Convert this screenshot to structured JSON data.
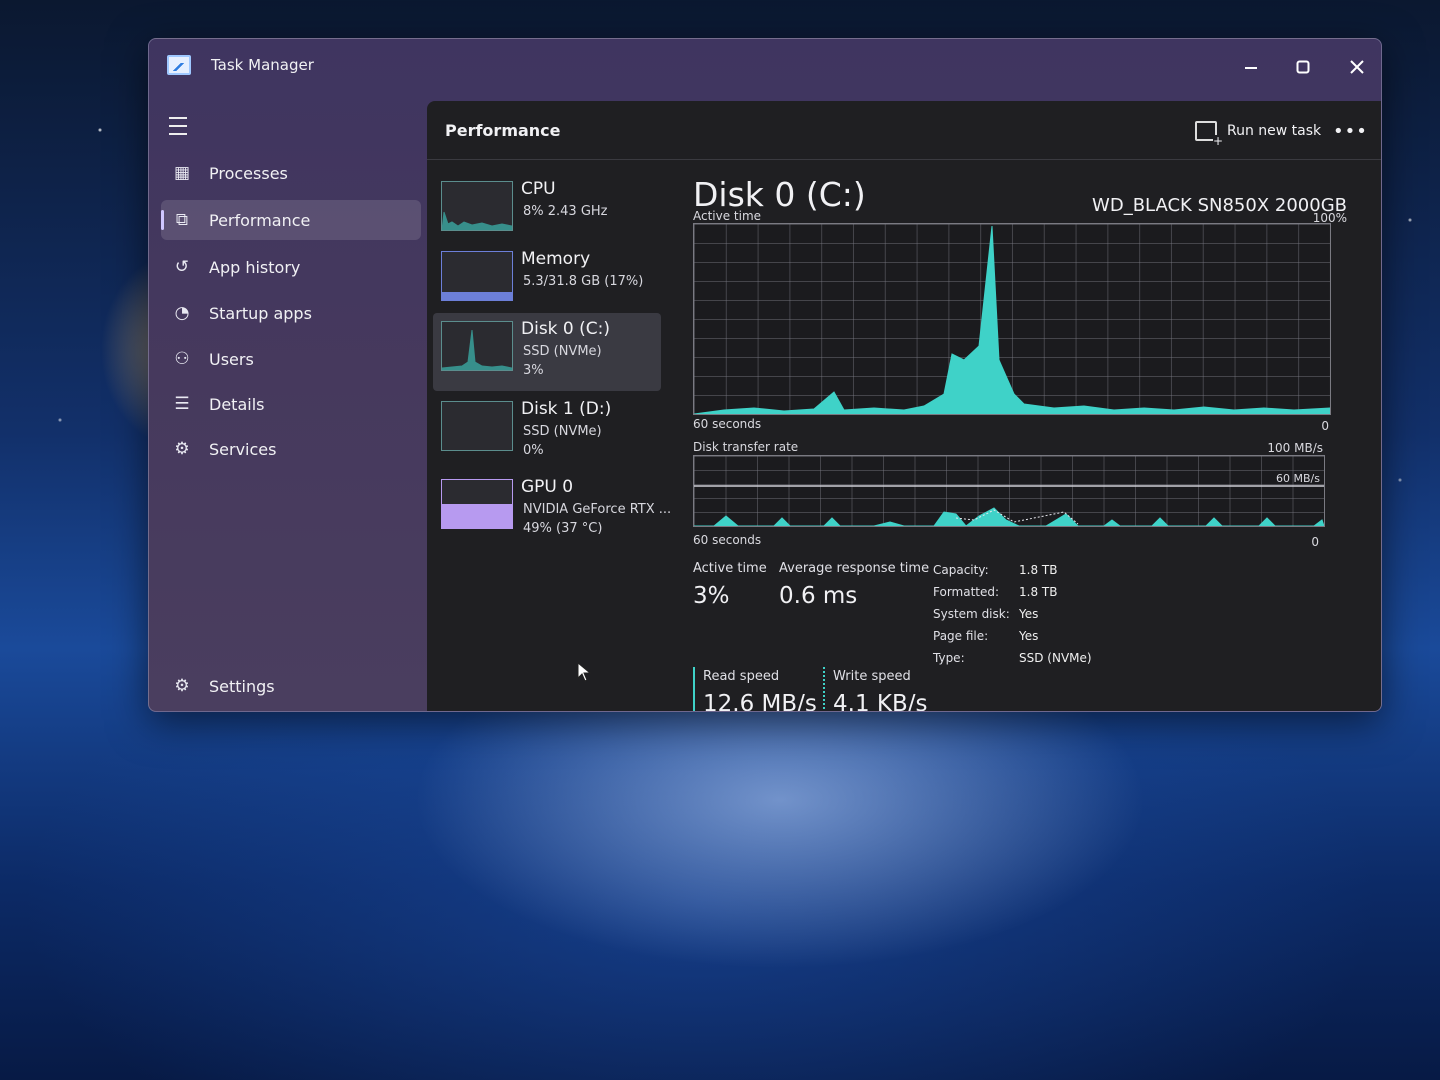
{
  "window": {
    "title": "Task Manager"
  },
  "nav": {
    "items": [
      {
        "label": "Processes",
        "icon": "processes-icon"
      },
      {
        "label": "Performance",
        "icon": "performance-icon"
      },
      {
        "label": "App history",
        "icon": "history-icon"
      },
      {
        "label": "Startup apps",
        "icon": "startup-icon"
      },
      {
        "label": "Users",
        "icon": "users-icon"
      },
      {
        "label": "Details",
        "icon": "details-icon"
      },
      {
        "label": "Services",
        "icon": "services-icon"
      }
    ],
    "settings_label": "Settings",
    "selected": "Performance"
  },
  "header": {
    "title": "Performance",
    "run_task_label": "Run new task"
  },
  "devices": [
    {
      "name": "CPU",
      "line1": "8%  2.43 GHz",
      "line2": ""
    },
    {
      "name": "Memory",
      "line1": "5.3/31.8 GB (17%)",
      "line2": ""
    },
    {
      "name": "Disk 0 (C:)",
      "line1": "SSD (NVMe)",
      "line2": "3%"
    },
    {
      "name": "Disk 1 (D:)",
      "line1": "SSD (NVMe)",
      "line2": "0%"
    },
    {
      "name": "GPU 0",
      "line1": "NVIDIA GeForce RTX ...",
      "line2": "49%  (37 °C)"
    }
  ],
  "detail": {
    "title": "Disk 0 (C:)",
    "model": "WD_BLACK SN850X 2000GB",
    "graph1": {
      "label": "Active time",
      "max": "100%",
      "time": "60 seconds",
      "min": "0"
    },
    "graph2": {
      "label": "Disk transfer rate",
      "max": "100 MB/s",
      "line_label": "60 MB/s",
      "time": "60 seconds",
      "min": "0"
    },
    "stats": {
      "active_time_label": "Active time",
      "active_time": "3%",
      "response_label": "Average response time",
      "response": "0.6 ms",
      "read_label": "Read speed",
      "read": "12.6 MB/s",
      "write_label": "Write speed",
      "write": "4.1 KB/s"
    },
    "props": [
      {
        "k": "Capacity:",
        "v": "1.8 TB"
      },
      {
        "k": "Formatted:",
        "v": "1.8 TB"
      },
      {
        "k": "System disk:",
        "v": "Yes"
      },
      {
        "k": "Page file:",
        "v": "Yes"
      },
      {
        "k": "Type:",
        "v": "SSD (NVMe)"
      }
    ]
  },
  "colors": {
    "accent": "#3fd2c8",
    "gpu": "#b79af0",
    "memory": "#6c7fd8"
  }
}
